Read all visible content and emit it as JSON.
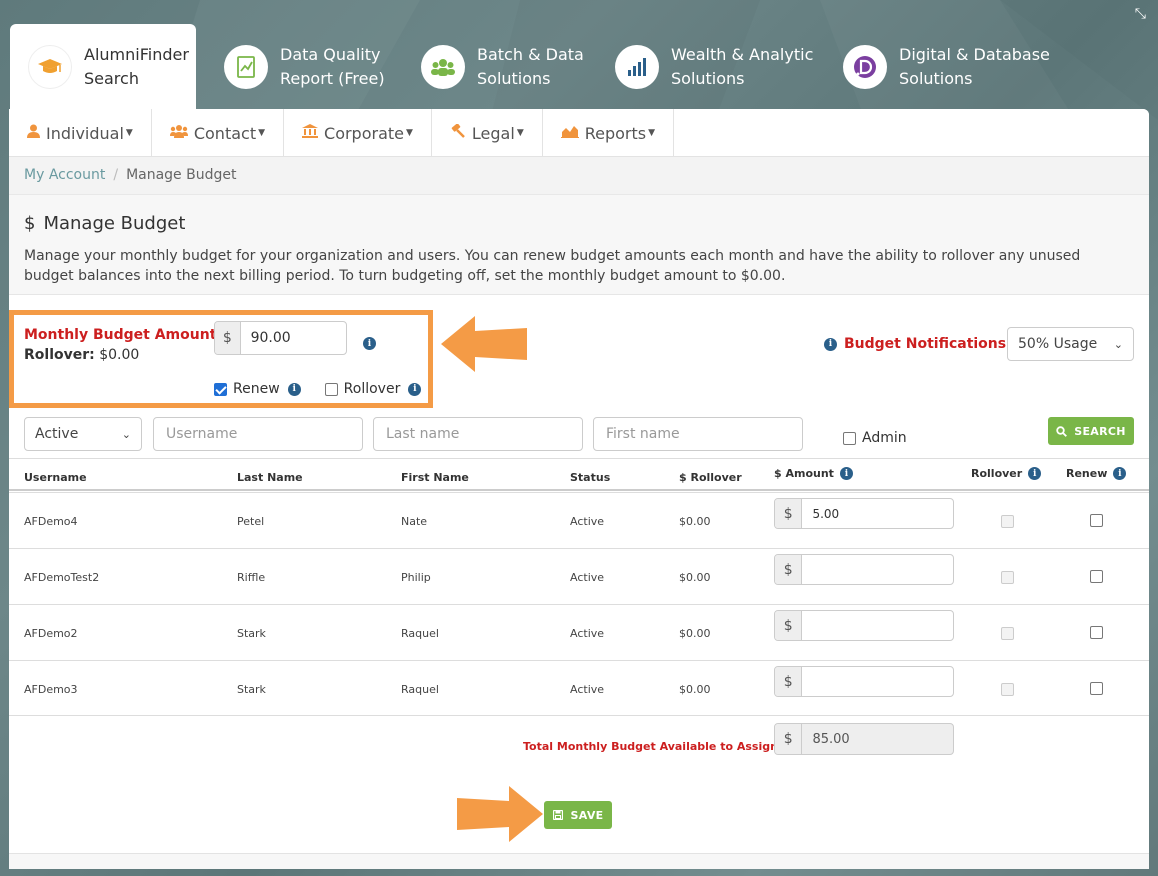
{
  "top_tabs": [
    {
      "label_line1": "AlumniFinder",
      "label_line2": "Search",
      "icon": "graduation-cap-icon"
    },
    {
      "label_line1": "Data Quality",
      "label_line2": "Report (Free)",
      "icon": "report-icon"
    },
    {
      "label_line1": "Batch & Data",
      "label_line2": "Solutions",
      "icon": "group-icon"
    },
    {
      "label_line1": "Wealth & Analytic",
      "label_line2": "Solutions",
      "icon": "bar-chart-icon"
    },
    {
      "label_line1": "Digital & Database",
      "label_line2": "Solutions",
      "icon": "digital-d-icon"
    }
  ],
  "menu": [
    {
      "label": "Individual",
      "icon": "user-icon"
    },
    {
      "label": "Contact",
      "icon": "users-icon"
    },
    {
      "label": "Corporate",
      "icon": "bank-icon"
    },
    {
      "label": "Legal",
      "icon": "gavel-icon"
    },
    {
      "label": "Reports",
      "icon": "area-chart-icon"
    }
  ],
  "breadcrumb": {
    "link": "My Account",
    "current": "Manage Budget"
  },
  "header": {
    "title": "Manage Budget",
    "title_icon": "$",
    "description": "Manage your monthly budget for your organization and users.  You can renew budget amounts each month and have the ability to rollover any unused budget balances into the next billing period.  To turn budgeting off, set the monthly budget amount to $0.00."
  },
  "budget": {
    "amount_label": "Monthly Budget Amount:",
    "rollover_label": "Rollover:",
    "rollover_value": "$0.00",
    "currency": "$",
    "amount_value": "90.00",
    "renew_label": "Renew",
    "renew_checked": true,
    "rollover_check_label": "Rollover",
    "rollover_checked": false,
    "notifications_label": "Budget Notifications:",
    "notifications_value": "50% Usage"
  },
  "filters": {
    "status_value": "Active",
    "username_placeholder": "Username",
    "lastname_placeholder": "Last name",
    "firstname_placeholder": "First name",
    "admin_label": "Admin",
    "search_label": "SEARCH"
  },
  "table": {
    "headers": {
      "username": "Username",
      "last_name": "Last Name",
      "first_name": "First Name",
      "status": "Status",
      "rollover_amt": "$ Rollover",
      "amount": "$ Amount",
      "rollover": "Rollover",
      "renew": "Renew"
    },
    "rows": [
      {
        "username": "AFDemo4",
        "last_name": "Petel",
        "first_name": "Nate",
        "status": "Active",
        "rollover": "$0.00",
        "amount": "5.00"
      },
      {
        "username": "AFDemoTest2",
        "last_name": "Riffle",
        "first_name": "Philip",
        "status": "Active",
        "rollover": "$0.00",
        "amount": ""
      },
      {
        "username": "AFDemo2",
        "last_name": "Stark",
        "first_name": "Raquel",
        "status": "Active",
        "rollover": "$0.00",
        "amount": ""
      },
      {
        "username": "AFDemo3",
        "last_name": "Stark",
        "first_name": "Raquel",
        "status": "Active",
        "rollover": "$0.00",
        "amount": ""
      }
    ],
    "total_label": "Total Monthly Budget Available to Assign:",
    "total_value": "85.00"
  },
  "save_label": "SAVE",
  "colors": {
    "accent_orange": "#f49b46",
    "green": "#7ab648",
    "red": "#cc1f1f",
    "info_blue": "#2a5f8a"
  }
}
